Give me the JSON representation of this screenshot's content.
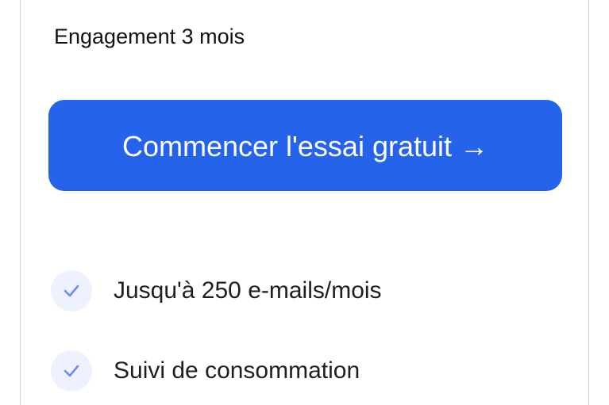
{
  "plan": {
    "commitment": "Engagement 3 mois",
    "cta_label": "Commencer l'essai gratuit →",
    "features": [
      {
        "label": "Jusqu'à 250 e-mails/mois",
        "icon": "check-icon"
      },
      {
        "label": "Suivi de consommation",
        "icon": "check-icon"
      }
    ]
  },
  "colors": {
    "accent": "#2563eb",
    "check_bg": "#eef2ff",
    "check_stroke": "#6b8ef5"
  }
}
